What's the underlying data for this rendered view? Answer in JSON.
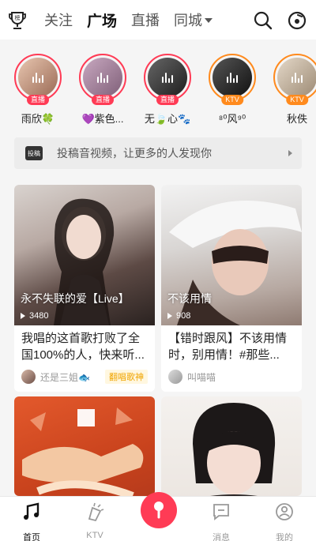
{
  "header": {
    "tabs": [
      {
        "label": "关注"
      },
      {
        "label": "广场",
        "active": true
      },
      {
        "label": "直播"
      },
      {
        "label": "同城"
      }
    ],
    "icons": {
      "rank": "rank-trophy-icon",
      "search": "search-icon",
      "record": "record-icon"
    }
  },
  "live": [
    {
      "name": "雨欣🍀",
      "badge": "直播",
      "type": "live",
      "bg": "#c7a08a"
    },
    {
      "name": "💜紫色...",
      "badge": "直播",
      "type": "live",
      "bg": "#a58aa0"
    },
    {
      "name": "无🍃心🐾",
      "badge": "直播",
      "type": "live",
      "bg": "#4a4a4a"
    },
    {
      "name": "⁸⁰风⁹⁰",
      "badge": "KTV",
      "type": "ktv",
      "bg": "#2e2e2e"
    },
    {
      "name": "秋佚",
      "badge": "KTV",
      "type": "ktv",
      "bg": "#c9b9a5"
    }
  ],
  "banner": {
    "icon_label": "投稿",
    "text": "投稿音视频，让更多的人发现你"
  },
  "cards": [
    {
      "title": "永不失联的爱【Live】",
      "plays": "3480",
      "desc": "我唱的这首歌打败了全国100%的人，快来听...",
      "author": "还是三姐🐟",
      "tag": "翻唱歌神"
    },
    {
      "title": "不该用情",
      "plays": "908",
      "desc": "【错时跟风】不该用情时，别用情！#那些...",
      "author": "叫喵喵",
      "tag": ""
    },
    {
      "title": "",
      "plays": "",
      "desc": "",
      "author": "",
      "tag": ""
    },
    {
      "title": "",
      "plays": "",
      "desc": "",
      "author": "",
      "tag": ""
    }
  ],
  "nav": [
    {
      "label": "首页",
      "icon": "home-music-icon",
      "active": true
    },
    {
      "label": "KTV",
      "icon": "ktv-icon"
    },
    {
      "label": "",
      "icon": "microphone-icon"
    },
    {
      "label": "消息",
      "icon": "message-icon"
    },
    {
      "label": "我的",
      "icon": "profile-icon"
    }
  ],
  "colors": {
    "accent": "#ff3b55",
    "ktv": "#ff8a1d",
    "tag": "#f0a500"
  }
}
